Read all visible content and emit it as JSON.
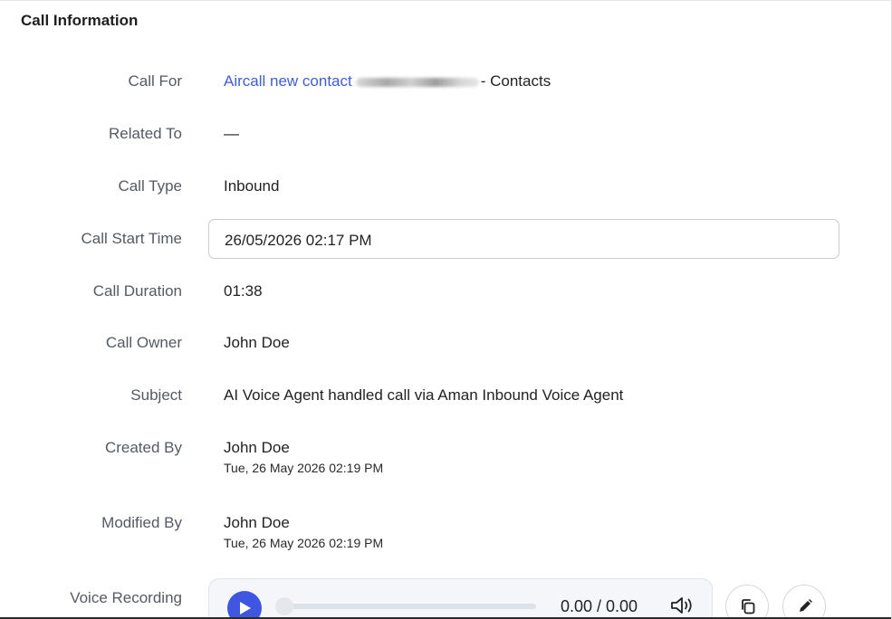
{
  "section": {
    "title": "Call Information"
  },
  "fields": {
    "call_for": {
      "label": "Call For",
      "link_text": "Aircall new contact",
      "suffix": "- Contacts"
    },
    "related_to": {
      "label": "Related To",
      "value": "—"
    },
    "call_type": {
      "label": "Call Type",
      "value": "Inbound"
    },
    "call_start_time": {
      "label": "Call Start Time",
      "value": "26/05/2026 02:17 PM"
    },
    "call_duration": {
      "label": "Call Duration",
      "value": "01:38"
    },
    "call_owner": {
      "label": "Call Owner",
      "value": "John Doe"
    },
    "subject": {
      "label": "Subject",
      "value": "AI Voice Agent handled call via Aman Inbound Voice Agent"
    },
    "created_by": {
      "label": "Created By",
      "name": "John Doe",
      "timestamp": "Tue, 26 May 2026 02:19 PM"
    },
    "modified_by": {
      "label": "Modified By",
      "name": "John Doe",
      "timestamp": "Tue, 26 May 2026 02:19 PM"
    },
    "voice_recording": {
      "label": "Voice Recording",
      "time_display": "0.00 / 0.00",
      "progress": 0
    }
  },
  "icons": {
    "play": "play-icon",
    "volume": "volume-icon",
    "copy": "copy-icon",
    "edit": "pencil-icon"
  },
  "colors": {
    "link": "#3e5ed6",
    "play_button": "#3f57e0",
    "label": "#555a62"
  }
}
